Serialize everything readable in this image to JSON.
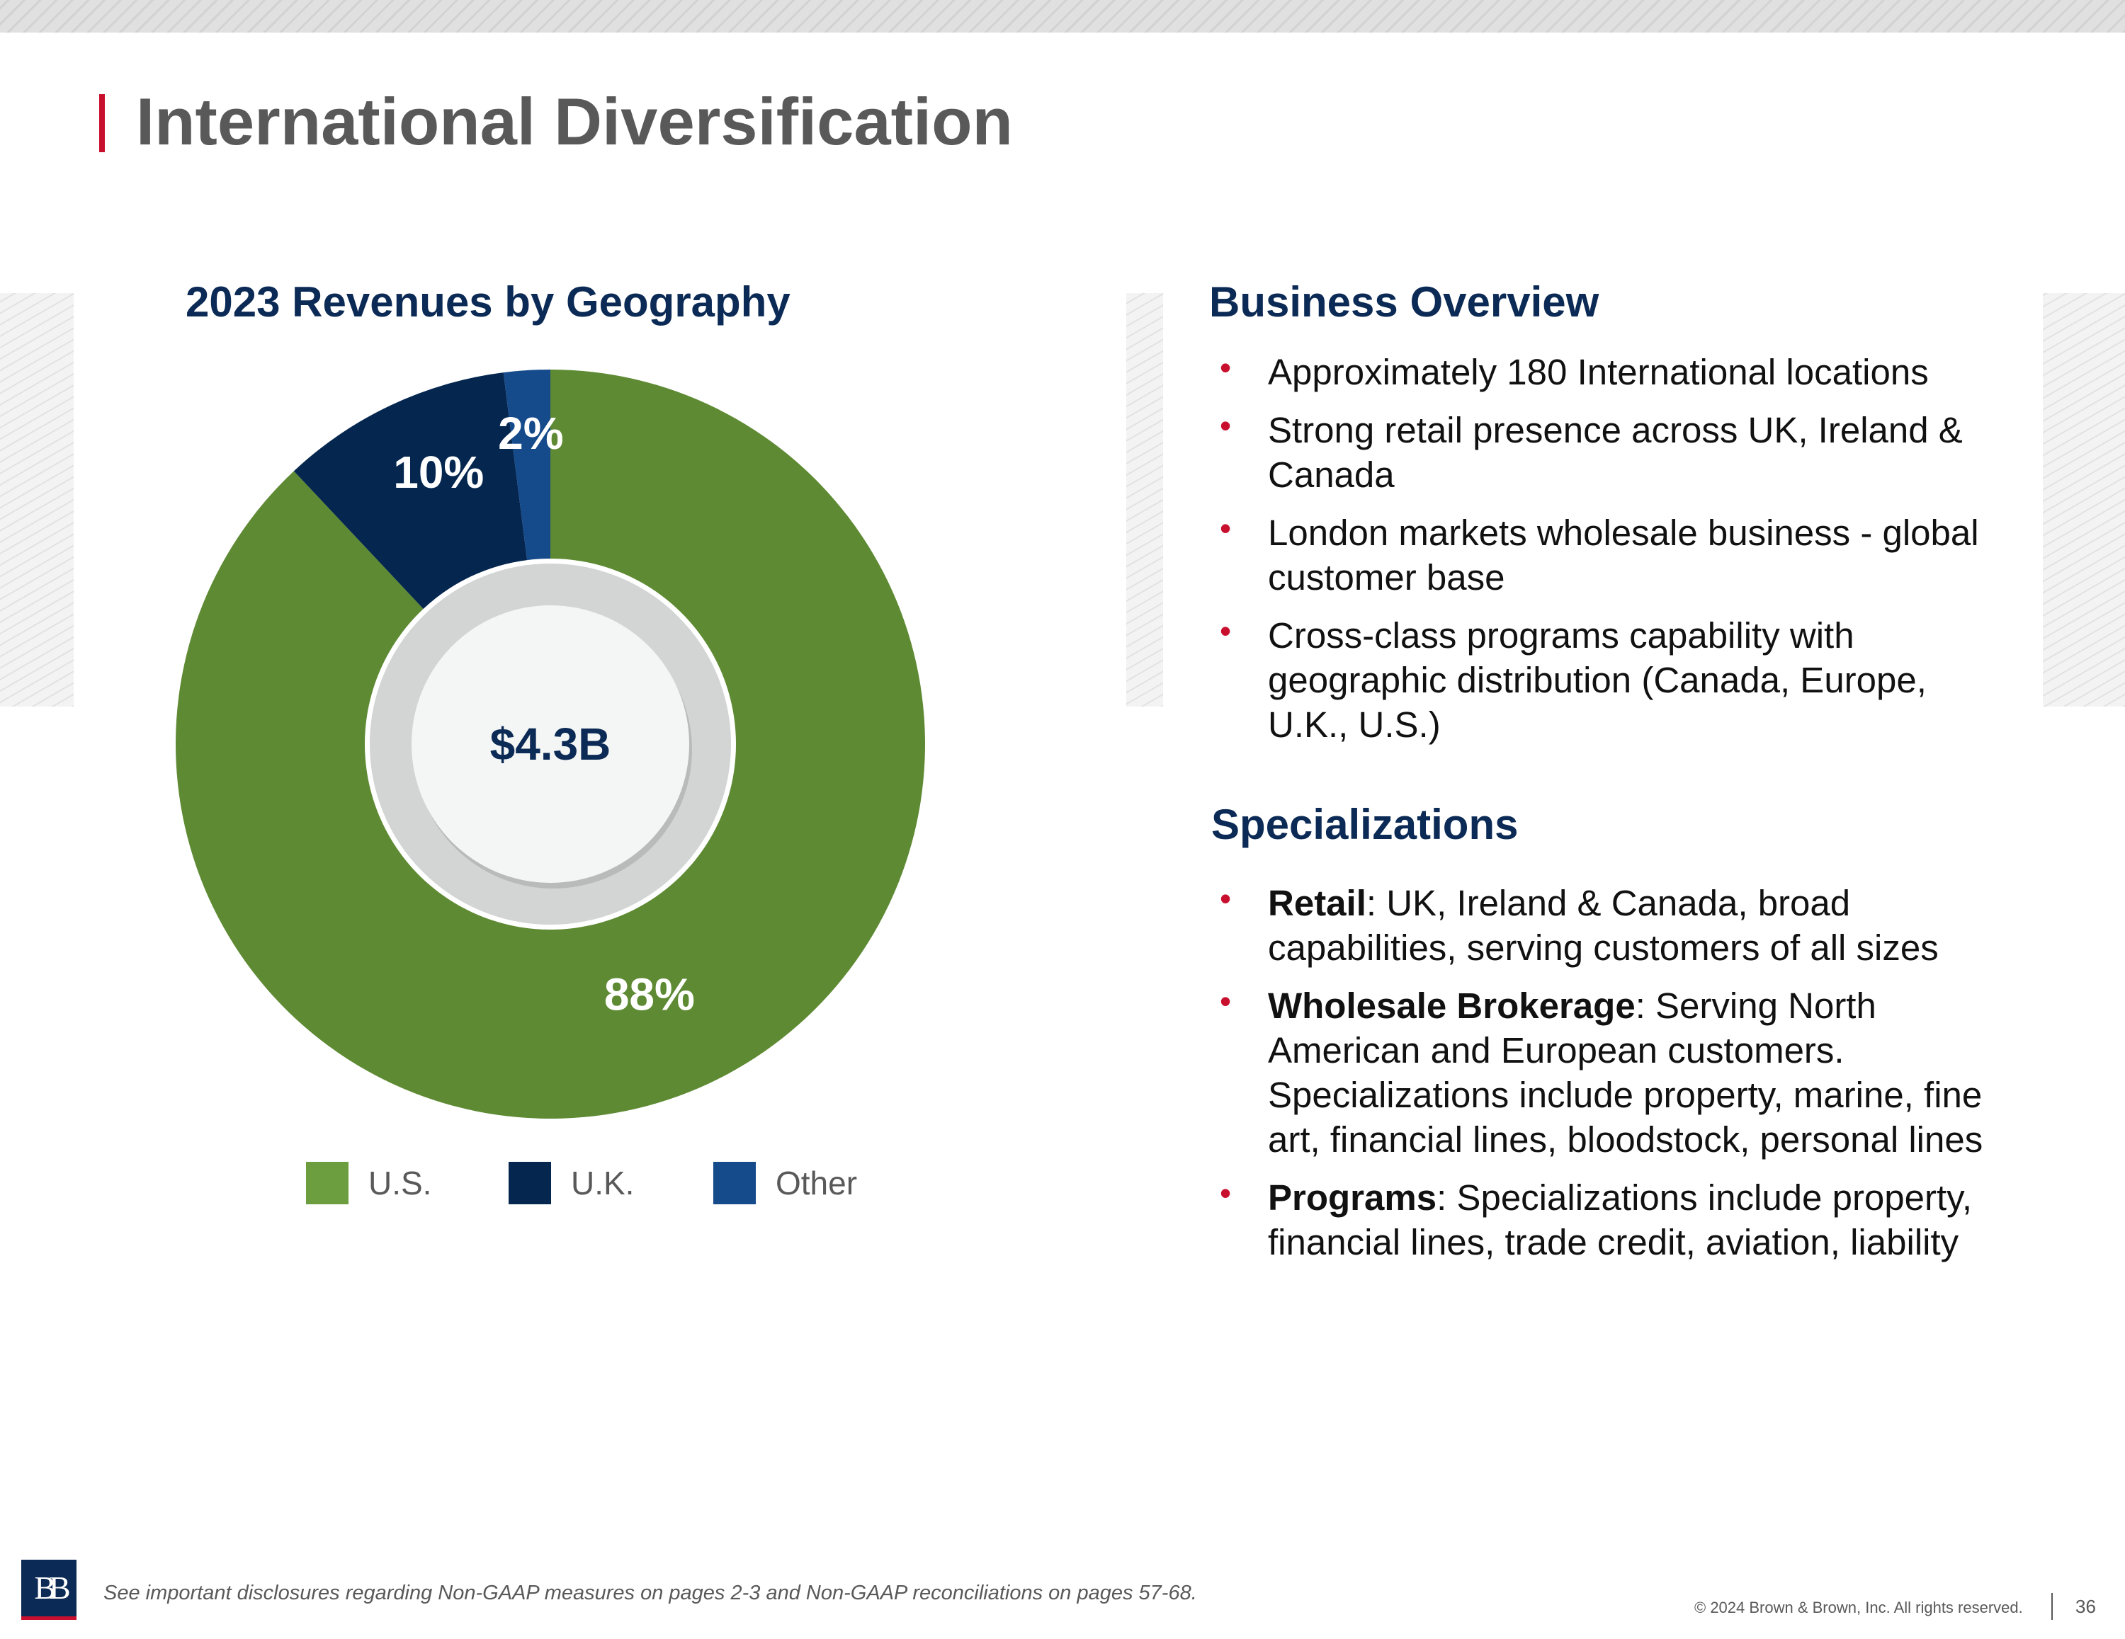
{
  "page": {
    "title": "International Diversification",
    "footnote": "See important disclosures regarding Non-GAAP measures on pages 2-3 and Non-GAAP reconciliations on pages 57-68.",
    "copyright": "© 2024 Brown & Brown, Inc. All rights reserved.",
    "page_number": "36",
    "logo_text": "BB"
  },
  "colors": {
    "accent_red": "#c8102e",
    "navy": "#0b2a55",
    "us_slice": "#5e8a33",
    "us_legend": "#6c9e3f",
    "uk": "#04264f",
    "other": "#154a8b",
    "center_ring": "#d3d5d4",
    "center_fill": "#f4f6f5"
  },
  "chart_data": {
    "type": "pie",
    "title": "2023 Revenues by Geography",
    "center_label": "$4.3B",
    "categories": [
      "U.S.",
      "U.K.",
      "Other"
    ],
    "values": [
      88,
      10,
      2
    ],
    "value_labels": [
      "88%",
      "10%",
      "2%"
    ],
    "legend_position": "bottom"
  },
  "business_overview": {
    "heading": "Business Overview",
    "bullets": [
      "Approximately 180 International locations",
      "Strong retail presence across UK, Ireland & Canada",
      "London markets wholesale business - global customer base",
      "Cross-class programs capability with geographic distribution (Canada, Europe, U.K., U.S.)"
    ]
  },
  "specializations": {
    "heading": "Specializations",
    "bullets": [
      {
        "bold": "Retail",
        "text": ": UK, Ireland & Canada, broad capabilities, serving customers of all sizes"
      },
      {
        "bold": "Wholesale Brokerage",
        "text": ": Serving North American and European customers. Specializations include property, marine, fine art, financial lines, bloodstock, personal lines"
      },
      {
        "bold": "Programs",
        "text": ": Specializations include property, financial lines, trade credit, aviation, liability"
      }
    ]
  },
  "bullet_glyph": "•"
}
